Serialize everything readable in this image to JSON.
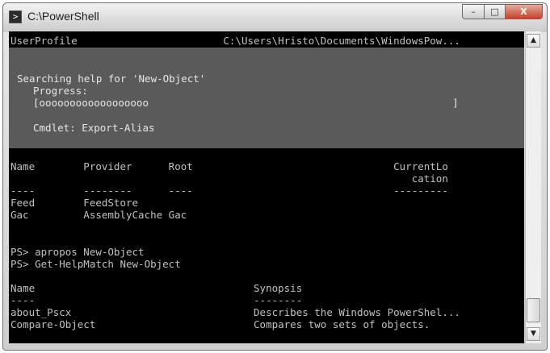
{
  "window": {
    "title": "C:\\PowerShell",
    "icon": "powershell-icon",
    "controls": {
      "minimize": "–",
      "maximize": "□",
      "close": "X"
    }
  },
  "console": {
    "top_line": "UserProfile                        C:\\Users\\Hristo\\Documents\\WindowsPow...",
    "progress": {
      "activity": "Searching help for 'New-Object'",
      "status_label": "Progress:",
      "bar": "[oooooooooooooooooo                                                  ]",
      "current_operation": "Cmdlet: Export-Alias"
    },
    "drive_table": {
      "header_line1": "Name        Provider      Root                                 CurrentLo",
      "header_line2": "                                                                  cation",
      "separator": "----        --------      ----                                 ---------",
      "rows": [
        "Feed        FeedStore",
        "Gac         AssemblyCache Gac"
      ]
    },
    "commands": [
      "PS> apropos New-Object",
      "PS> Get-HelpMatch New-Object"
    ],
    "help_table": {
      "header": "Name                                    Synopsis",
      "separator": "----                                    --------",
      "rows": [
        "about_Pscx                              Describes the Windows PowerShel...",
        "Compare-Object                          Compares two sets of objects."
      ]
    }
  },
  "scrollbar": {
    "up_arrow": "▲",
    "down_arrow": "▼"
  }
}
